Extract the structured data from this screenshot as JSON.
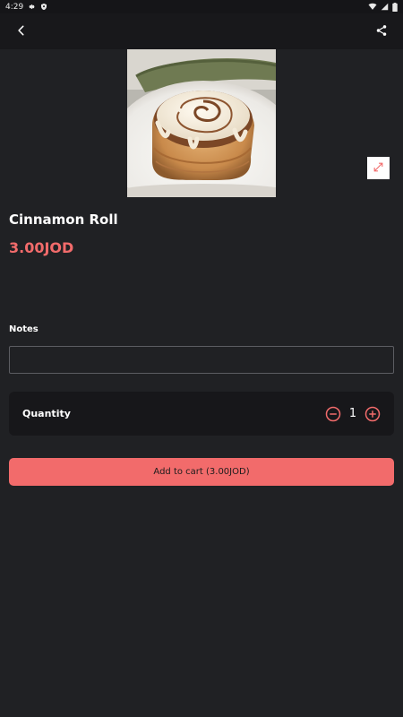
{
  "status_bar": {
    "time": "4:29",
    "icons": [
      "gear-icon",
      "shield-icon",
      "wifi-icon",
      "signal-icon",
      "battery-icon"
    ]
  },
  "app_bar": {
    "back_icon": "back-arrow-icon",
    "share_icon": "share-icon"
  },
  "product": {
    "name": "Cinnamon Roll",
    "price": "3.00JOD",
    "image_icon": "cinnamon-roll-photo",
    "expand_icon": "expand-icon"
  },
  "notes": {
    "label": "Notes",
    "value": "",
    "placeholder": ""
  },
  "quantity": {
    "label": "Quantity",
    "value": "1"
  },
  "cart": {
    "button_label": "Add to cart (3.00JOD)"
  },
  "colors": {
    "background": "#202124",
    "accent": "#f26b6b",
    "card": "#17171a"
  }
}
